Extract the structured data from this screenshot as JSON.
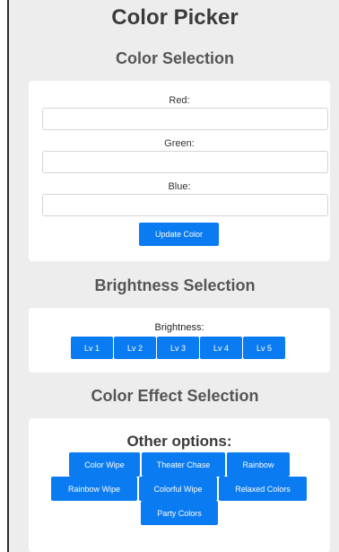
{
  "page": {
    "title": "Color Picker"
  },
  "color_section": {
    "title": "Color Selection",
    "fields": [
      {
        "label": "Red:",
        "value": ""
      },
      {
        "label": "Green:",
        "value": ""
      },
      {
        "label": "Blue:",
        "value": ""
      }
    ],
    "update_button": "Update Color"
  },
  "brightness_section": {
    "title": "Brightness Selection",
    "label": "Brightness:",
    "levels": [
      "Lv 1",
      "Lv 2",
      "Lv 3",
      "Lv 4",
      "Lv 5"
    ]
  },
  "effect_section": {
    "title": "Color Effect Selection",
    "subtitle": "Other options:",
    "options": [
      "Color Wipe",
      "Theater Chase",
      "Rainbow",
      "Rainbow Wipe",
      "Colorful Wipe",
      "Relaxed Colors",
      "Party Colors"
    ]
  },
  "colors": {
    "accent": "#0a7bf0",
    "background": "#ededed",
    "card": "#ffffff"
  }
}
